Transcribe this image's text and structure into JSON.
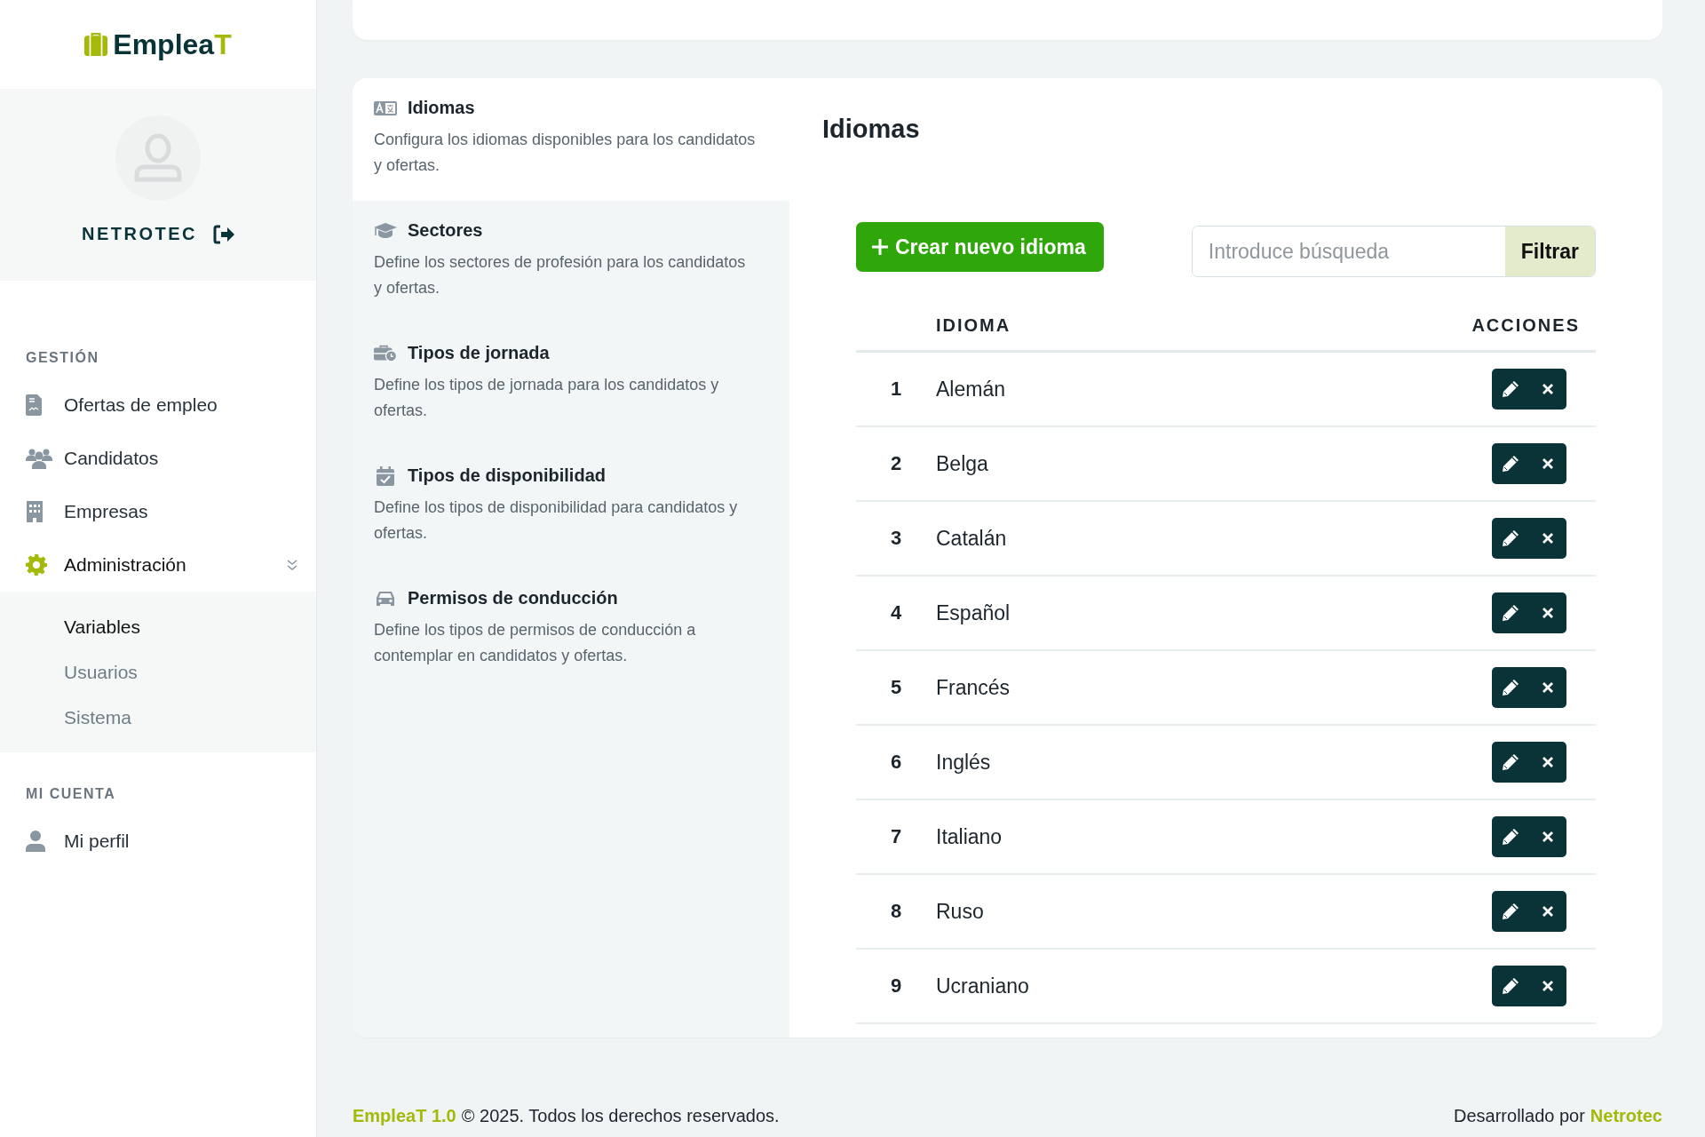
{
  "logo": {
    "text": "Emplea",
    "accent": "T"
  },
  "user": {
    "name": "NETROTEC"
  },
  "sidebar": {
    "sections": [
      {
        "title": "GESTIÓN",
        "items": [
          {
            "label": "Ofertas de empleo",
            "selected": false
          },
          {
            "label": "Candidatos",
            "selected": false
          },
          {
            "label": "Empresas",
            "selected": false
          },
          {
            "label": "Administración",
            "selected": true,
            "expanded": true,
            "children": [
              {
                "label": "Variables",
                "selected": true
              },
              {
                "label": "Usuarios",
                "selected": false
              },
              {
                "label": "Sistema",
                "selected": false
              }
            ]
          }
        ]
      },
      {
        "title": "MI CUENTA",
        "items": [
          {
            "label": "Mi perfil",
            "selected": false
          }
        ]
      }
    ]
  },
  "settings_menu": [
    {
      "title": "Idiomas",
      "description": "Configura los idiomas disponibles para los candidatos y ofertas.",
      "selected": true
    },
    {
      "title": "Sectores",
      "description": "Define los sectores de profesión para los candidatos y ofertas.",
      "selected": false
    },
    {
      "title": "Tipos de jornada",
      "description": "Define los tipos de jornada para los candidatos y ofertas.",
      "selected": false
    },
    {
      "title": "Tipos de disponibilidad",
      "description": "Define los tipos de disponibilidad para candidatos y ofertas.",
      "selected": false
    },
    {
      "title": "Permisos de conducción",
      "description": "Define los tipos de permisos de conducción a contemplar en candidatos y ofertas.",
      "selected": false
    }
  ],
  "content": {
    "heading": "Idiomas",
    "create_button": "Crear nuevo idioma",
    "search": {
      "placeholder": "Introduce búsqueda"
    },
    "filter_button": "Filtrar",
    "table": {
      "columns": [
        "IDIOMA",
        "ACCIONES"
      ],
      "rows": [
        {
          "number": "1",
          "name": "Alemán"
        },
        {
          "number": "2",
          "name": "Belga"
        },
        {
          "number": "3",
          "name": "Catalán"
        },
        {
          "number": "4",
          "name": "Español"
        },
        {
          "number": "5",
          "name": "Francés"
        },
        {
          "number": "6",
          "name": "Inglés"
        },
        {
          "number": "7",
          "name": "Italiano"
        },
        {
          "number": "8",
          "name": "Ruso"
        },
        {
          "number": "9",
          "name": "Ucraniano"
        }
      ]
    }
  },
  "footer": {
    "brand": "EmpleaT 1.0",
    "copyright": "© 2025. Todos los derechos reservados.",
    "credit": "Desarrollado por",
    "credit_link": "Netrotec"
  }
}
